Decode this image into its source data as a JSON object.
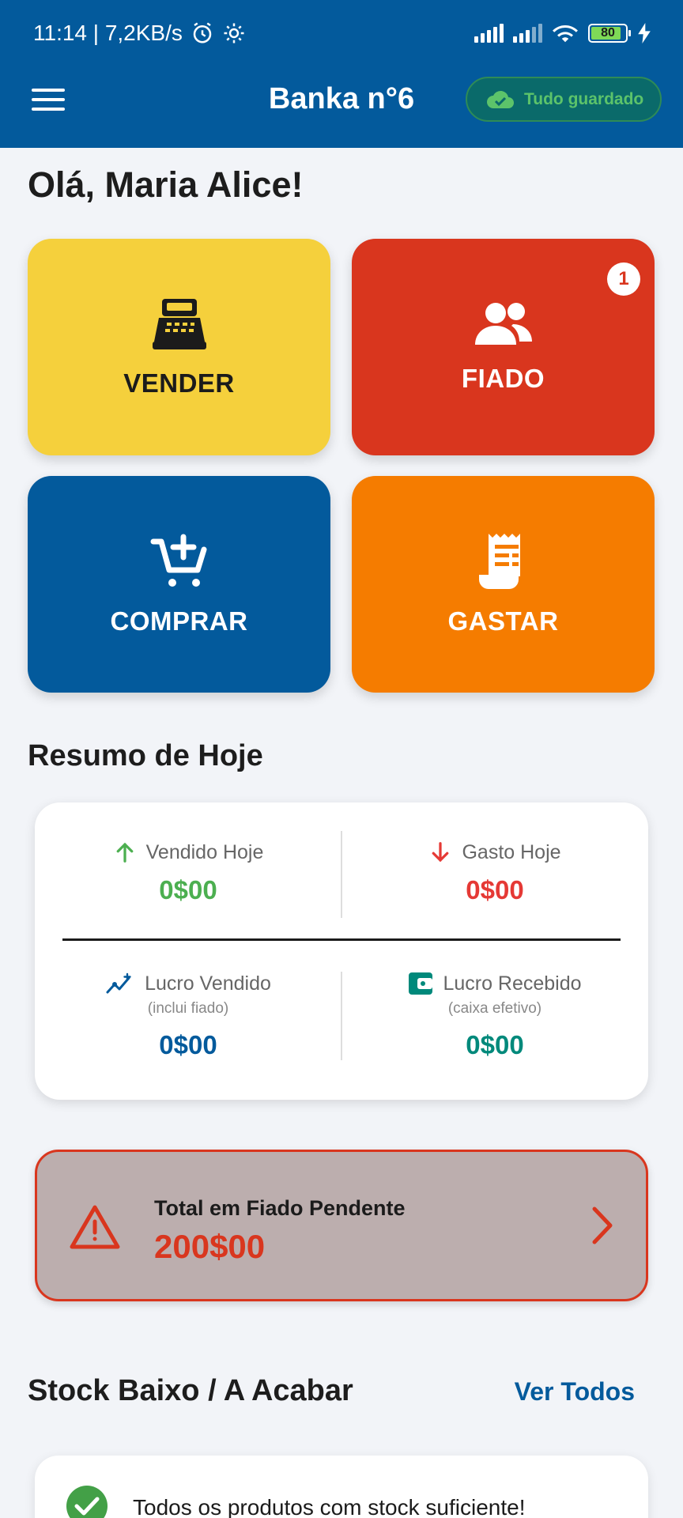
{
  "status": {
    "time": "11:14 | 7,2KB/s",
    "battery": "80"
  },
  "appbar": {
    "title": "Banka n°6",
    "saved_label": "Tudo guardado"
  },
  "greeting": "Olá, Maria Alice!",
  "actions": {
    "vender": "VENDER",
    "fiado": "FIADO",
    "fiado_badge": "1",
    "comprar": "COMPRAR",
    "gastar": "GASTAR"
  },
  "summary": {
    "title": "Resumo de Hoje",
    "vendido_label": "Vendido Hoje",
    "vendido_value": "0$00",
    "gasto_label": "Gasto Hoje",
    "gasto_value": "0$00",
    "lucro_vendido_label": "Lucro Vendido",
    "lucro_vendido_sub": "(inclui fiado)",
    "lucro_vendido_value": "0$00",
    "lucro_recebido_label": "Lucro Recebido",
    "lucro_recebido_sub": "(caixa efetivo)",
    "lucro_recebido_value": "0$00"
  },
  "fiado_pendente": {
    "label": "Total em Fiado Pendente",
    "value": "200$00"
  },
  "stock": {
    "title": "Stock Baixo / A Acabar",
    "ver_todos": "Ver Todos",
    "message": "Todos os produtos com stock suficiente!"
  },
  "colors": {
    "primary": "#035a9c",
    "yellow": "#f5d03c",
    "red": "#d9361e",
    "orange": "#f57c00",
    "green": "#4caf50",
    "teal": "#00897b"
  }
}
